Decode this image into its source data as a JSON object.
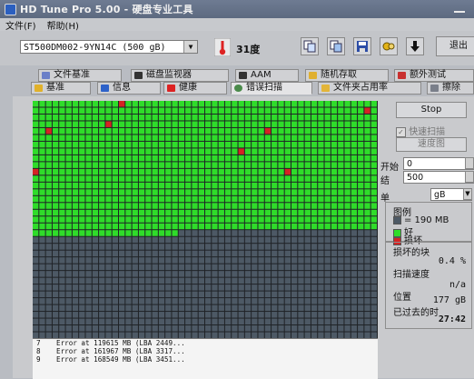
{
  "window": {
    "title": "HD Tune Pro 5.00 - 硬盘专业工具"
  },
  "menu": [
    "文件(F)",
    "帮助(H)"
  ],
  "toolbar": {
    "drive": "ST500DM002-9YN14C (500 gB)",
    "temperature": "31度",
    "exit_label": "退出",
    "buttons": [
      "copy-info-icon",
      "copy-screen-icon",
      "save-icon",
      "options-icon",
      "download-icon"
    ]
  },
  "tabs": {
    "row1": [
      "文件基准",
      "磁盘监视器",
      "AAM",
      "随机存取",
      "额外测试"
    ],
    "row2": [
      "基准",
      "信息",
      "健康",
      "错误扫描",
      "文件夹占用率",
      "擦除"
    ],
    "active": "错误扫描"
  },
  "scan": {
    "stop_label": "Stop",
    "quick_scan_label": "快速扫描",
    "quick_scan_checked": true,
    "speed_map_label": "速度图",
    "start_label": "开始",
    "start_value": "0",
    "end_label": "结",
    "end_value": "500",
    "unit_label": "单",
    "unit_value": "gB",
    "legend": {
      "title": "图例",
      "block_label": "= 190 MB",
      "ok_label": "好",
      "bad_label": "损坏"
    },
    "stats": {
      "damaged_label": "损坏的块",
      "damaged_value": "0.4 %",
      "speed_label": "扫描速度",
      "speed_value": "n/a",
      "position_label": "位置",
      "position_value": "177 gB",
      "elapsed_label": "已过去的时",
      "elapsed_value": "27:42"
    },
    "grid": {
      "progress_fraction": 0.555,
      "bad_blocks": [
        [
          13,
          0
        ],
        [
          50,
          1
        ],
        [
          11,
          3
        ],
        [
          2,
          4
        ],
        [
          35,
          4
        ],
        [
          31,
          7
        ],
        [
          0,
          10
        ],
        [
          38,
          10
        ]
      ]
    },
    "log": [
      {
        "num": "7",
        "text": "Error at 119615 MB (LBA 2449..."
      },
      {
        "num": "8",
        "text": "Error at 161967 MB (LBA 3317..."
      },
      {
        "num": "9",
        "text": "Error at 168549 MB (LBA 3451..."
      }
    ]
  },
  "colors": {
    "ok": "#2fdc2a",
    "bad": "#d52324",
    "pending": "#4d5965",
    "gridline": "#1f2226"
  }
}
